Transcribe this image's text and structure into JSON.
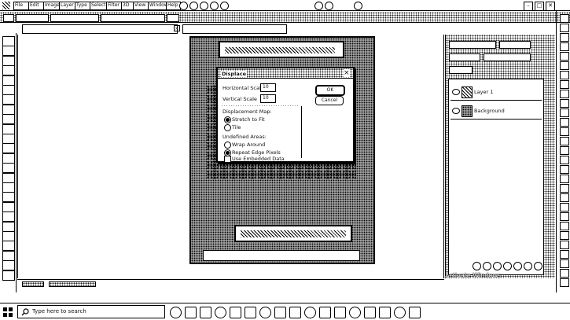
{
  "titlebar": {
    "menu": [
      "File",
      "Edit",
      "Image",
      "Layer",
      "Type",
      "Select",
      "Filter",
      "3D",
      "View",
      "Window",
      "Help"
    ],
    "controls": [
      "–",
      "□",
      "✕"
    ]
  },
  "documents": {
    "tabs": [
      "",
      ""
    ]
  },
  "dialog": {
    "title": "Displace",
    "close": "×",
    "ok_label": "OK",
    "cancel_label": "Cancel",
    "horizontal_scale_label": "Horizontal Scale",
    "horizontal_scale_value": "10",
    "vertical_scale_label": "Vertical Scale",
    "vertical_scale_value": "10",
    "displacement_map_label": "Displacement Map:",
    "option_stretch": "Stretch to Fit",
    "option_tile": "Tile",
    "undefined_areas_label": "Undefined Areas:",
    "option_wrap": "Wrap Around",
    "option_repeat": "Repeat Edge Pixels",
    "embedded_data_label": "Use Embedded Data"
  },
  "layers": {
    "rows": [
      {
        "name": "Layer 1"
      },
      {
        "name": "Background"
      }
    ]
  },
  "overlay": {
    "activate_windows": "Activate Windows"
  },
  "taskbar": {
    "search_placeholder": "Type here to search"
  }
}
